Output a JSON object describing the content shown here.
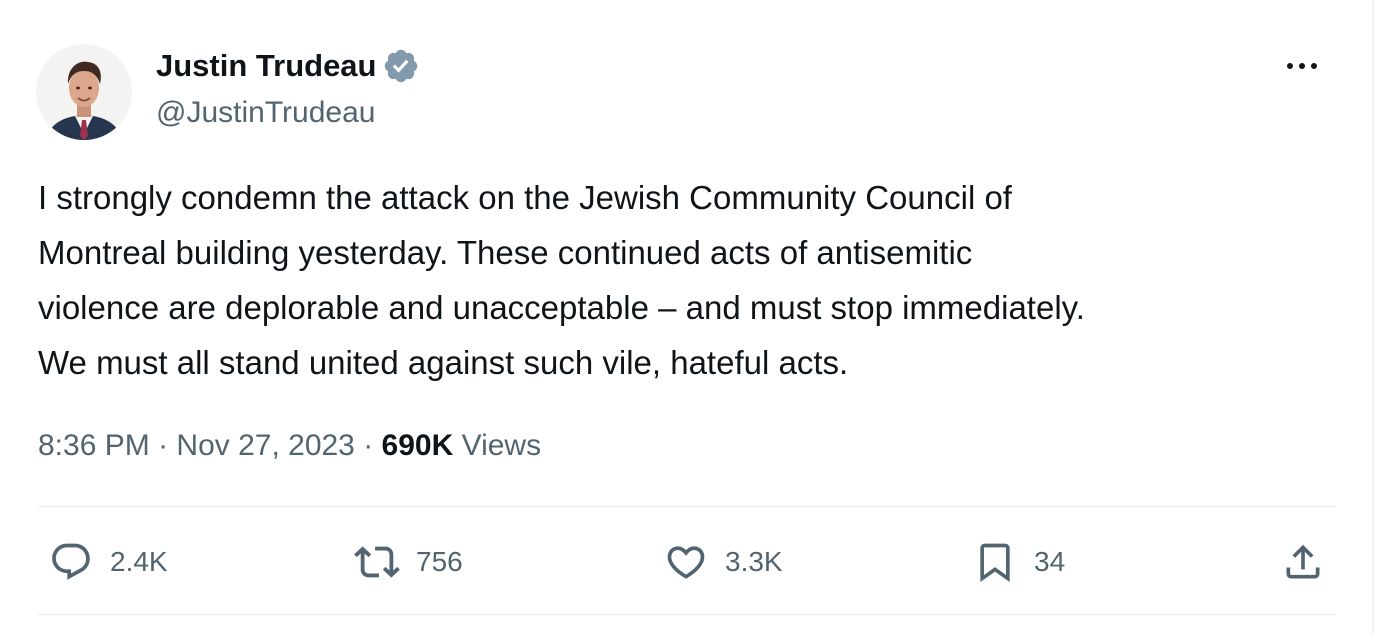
{
  "author": {
    "name": "Justin Trudeau",
    "handle": "@JustinTrudeau",
    "verified_icon": "verified-badge-icon",
    "verified_color": "#829aab"
  },
  "more_icon": "more-horizontal-icon",
  "tweet": {
    "text": "I strongly condemn the attack on the Jewish Community Council of\nMontreal building yesterday. These continued acts of antisemitic\nviolence are deplorable and unacceptable – and must stop immediately.\nWe must all stand united against such vile, hateful acts."
  },
  "meta": {
    "time": "8:36 PM",
    "date": "Nov 27, 2023",
    "separator": " · ",
    "views_count": "690K",
    "views_label": "Views"
  },
  "actions": [
    {
      "name": "reply",
      "icon": "reply-icon",
      "count": "2.4K"
    },
    {
      "name": "repost",
      "icon": "repost-icon",
      "count": "756"
    },
    {
      "name": "like",
      "icon": "heart-icon",
      "count": "3.3K"
    },
    {
      "name": "bookmark",
      "icon": "bookmark-icon",
      "count": "34"
    },
    {
      "name": "share",
      "icon": "share-icon",
      "count": ""
    }
  ],
  "colors": {
    "text_primary": "#0f1419",
    "text_secondary": "#536471",
    "divider": "#e6eaec"
  }
}
